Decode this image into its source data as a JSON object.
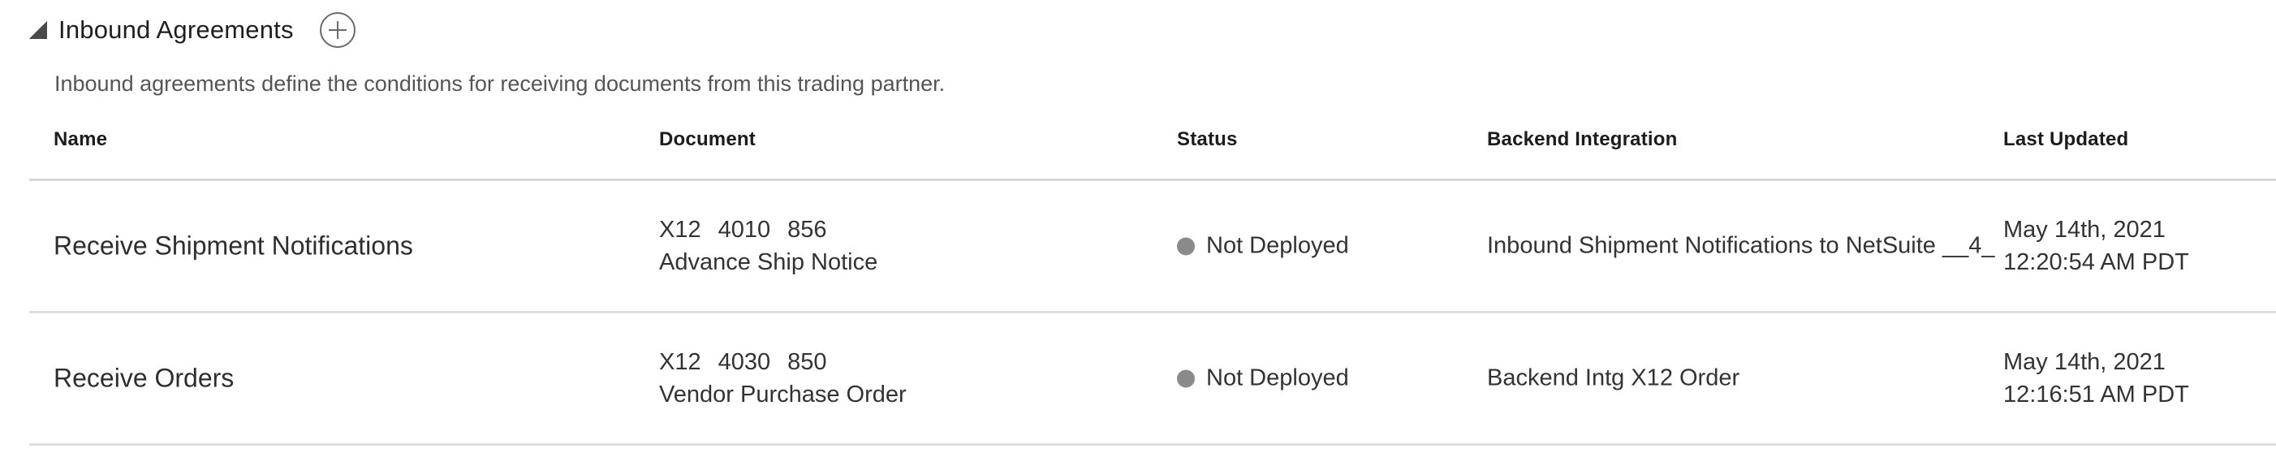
{
  "section": {
    "title": "Inbound Agreements",
    "description": "Inbound agreements define the conditions for receiving documents from this trading partner."
  },
  "table": {
    "columns": [
      "Name",
      "Document",
      "Status",
      "Backend Integration",
      "Last Updated"
    ],
    "rows": [
      {
        "name": "Receive Shipment Notifications",
        "doc_standard": "X12",
        "doc_version": "4010",
        "doc_type": "856",
        "doc_description": "Advance Ship Notice",
        "status": "Not Deployed",
        "backend": "Inbound Shipment Notifications to NetSuite __4_",
        "updated_date": "May 14th, 2021",
        "updated_time": "12:20:54 AM PDT"
      },
      {
        "name": "Receive Orders",
        "doc_standard": "X12",
        "doc_version": "4030",
        "doc_type": "850",
        "doc_description": "Vendor Purchase Order",
        "status": "Not Deployed",
        "backend": "Backend Intg X12 Order",
        "updated_date": "May 14th, 2021",
        "updated_time": "12:16:51 AM PDT"
      }
    ]
  },
  "icons": {
    "collapse": "collapse-triangle-icon",
    "add": "plus-circle-icon",
    "status": "status-dot-icon"
  },
  "colors": {
    "status_not_deployed": "#8a8a8a"
  }
}
